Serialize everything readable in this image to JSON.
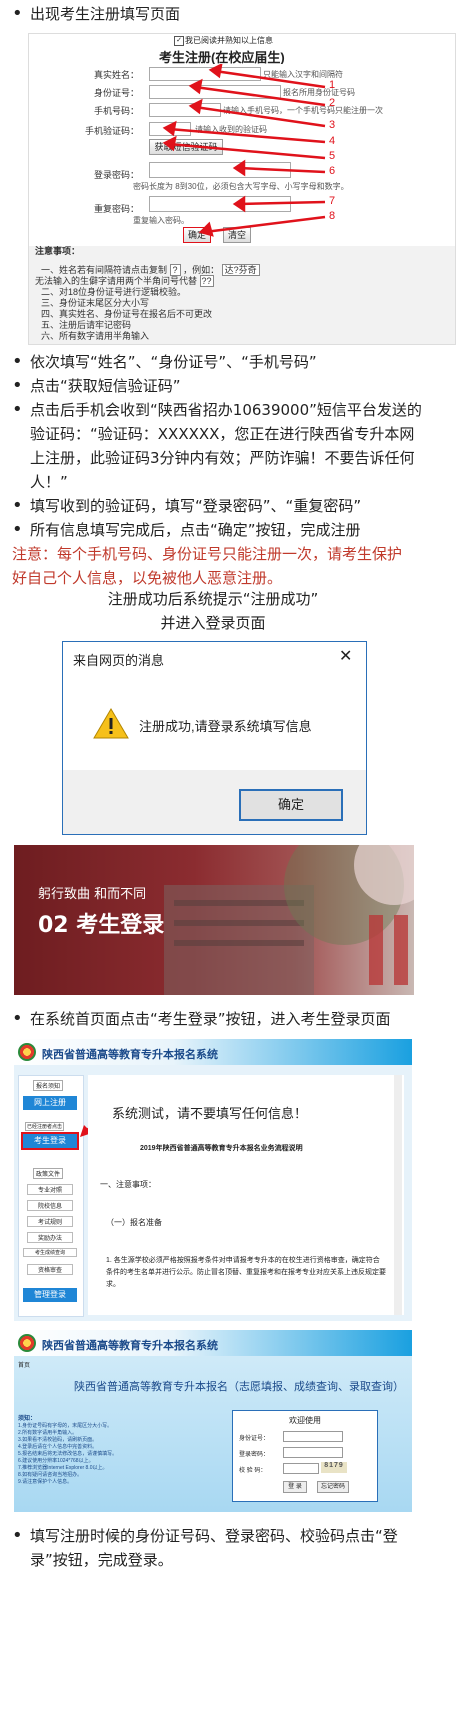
{
  "step_show_form": "出现考生注册填写页面",
  "reg_form": {
    "checkbox_label": "我已阅读并熟知以上信息",
    "title": "考生注册(在校应届生)",
    "fields": [
      {
        "label": "真实姓名：",
        "hint": "只能输入汉字和间隔符"
      },
      {
        "label": "身份证号：",
        "hint": "报名所用身份证号码"
      },
      {
        "label": "手机号码：",
        "hint": "请输入手机号码，一个手机号码只能注册一次"
      },
      {
        "label": "手机验证码：",
        "hint": "请输入收到的验证码"
      },
      {
        "label": "登录密码：",
        "hint": "密码长度为 8到30位，必须包含大写字母、小写字母和数字。"
      },
      {
        "label": "重复密码：",
        "hint": "重复输入密码。"
      }
    ],
    "sms_button": "获取短信验证码",
    "confirm_button": "确定",
    "clear_button": "清空",
    "markers": [
      "1",
      "2",
      "3",
      "4",
      "5",
      "6",
      "7",
      "8"
    ],
    "notes_title": "注意事项：",
    "note_1": "一、姓名若有间隔符请点击复制",
    "note_1_sample": "?",
    "note_1_example_label": "，例如：",
    "note_1_example": "达?芬奇",
    "note_2": "无法输入的生僻字请用两个半角问号代替",
    "note_2_sample": "??",
    "notes_rest": [
      "二、对18位身份证号进行逻辑校验。",
      "三、身份证末尾区分大小写",
      "四、真实姓名、身份证号在报名后不可更改",
      "五、注册后请牢记密码",
      "六、所有数字请用半角输入"
    ]
  },
  "bullets_1": [
    "依次填写“姓名”、“身份证号”、“手机号码”",
    "点击“获取短信验证码”",
    "点击后手机会收到“陕西省招办10639000”短信平台发送的验证码：“验证码：XXXXXX，您正在进行陕西省专升本网上注册，此验证码3分钟内有效；严防诈骗！不要告诉任何人！”",
    "填写收到的验证码，填写“登录密码”、“重复密码”",
    "所有信息填写完成后，点击“确定”按钮，完成注册"
  ],
  "warning": "注意：每个手机号码、身份证号只能注册一次，请考生保护好自己个人信息，以免被他人恶意注册。",
  "success_line1": "注册成功后系统提示“注册成功”",
  "success_line2": "并进入登录页面",
  "dialog": {
    "title": "来自网页的消息",
    "message": "注册成功,请登录系统填写信息",
    "ok": "确定"
  },
  "banner": {
    "slogan": "躬行致曲 和而不同",
    "heading": "02 考生登录"
  },
  "bullet_login": "在系统首页面点击“考生登录”按钮，进入考生登录页面",
  "site_title": "陕西省普通高等教育专升本报名系统",
  "portal": {
    "side_items": [
      "报名须知",
      "网上注册",
      "已经注册者点击",
      "考生登录",
      "政策文件",
      "专业对照",
      "院校信息",
      "考试规则",
      "奖励办法",
      "考生成绩查询",
      "资格审查",
      "管理登录"
    ],
    "notice_heading": "系统测试，请不要填写任何信息！",
    "doc_title": "2019年陕西省普通高等教育专升本报名业务流程说明",
    "section_1": "一、注意事项：",
    "section_1_1": "（一）报名准备",
    "para": "1. 各生源学校必须严格按照报考条件对申请报考专升本的在校生进行资格审查，确定符合条件的考生名单并进行公示。防止冒名顶替、重复报考和在报考专业对应关系上违反规定要求。"
  },
  "login_page": {
    "top_tag": "首页",
    "heading": "陕西省普通高等教育专升本报名（志愿填报、成绩查询、录取查询）",
    "welcome": "欢迎使用",
    "id_label": "身份证号：",
    "pwd_label": "登录密码：",
    "code_label": "校 验 码：",
    "captcha": "8179",
    "login_btn": "登 录",
    "forgot_btn": "忘记密码",
    "notes_title": "须知：",
    "notes": [
      "1.身份证号码有字母的，末尾区分大小写。",
      "2.所有数字请用半角输入。",
      "3.如果看不清校验码，请刷新页面。",
      "4.登录后请在个人信息中完善资料。",
      "5.报名结束后将无法修改信息，请谨慎填写。",
      "6.建议使用分辨率1024*768以上。",
      "7.推荐浏览器Internet Explorer 8.0以上。",
      "8.如有疑问请咨询当地招办。",
      "9.请注意保护个人信息。"
    ]
  },
  "bullet_final": "填写注册时候的身份证号码、登录密码、校验码点击“登录”按钮，完成登录。"
}
